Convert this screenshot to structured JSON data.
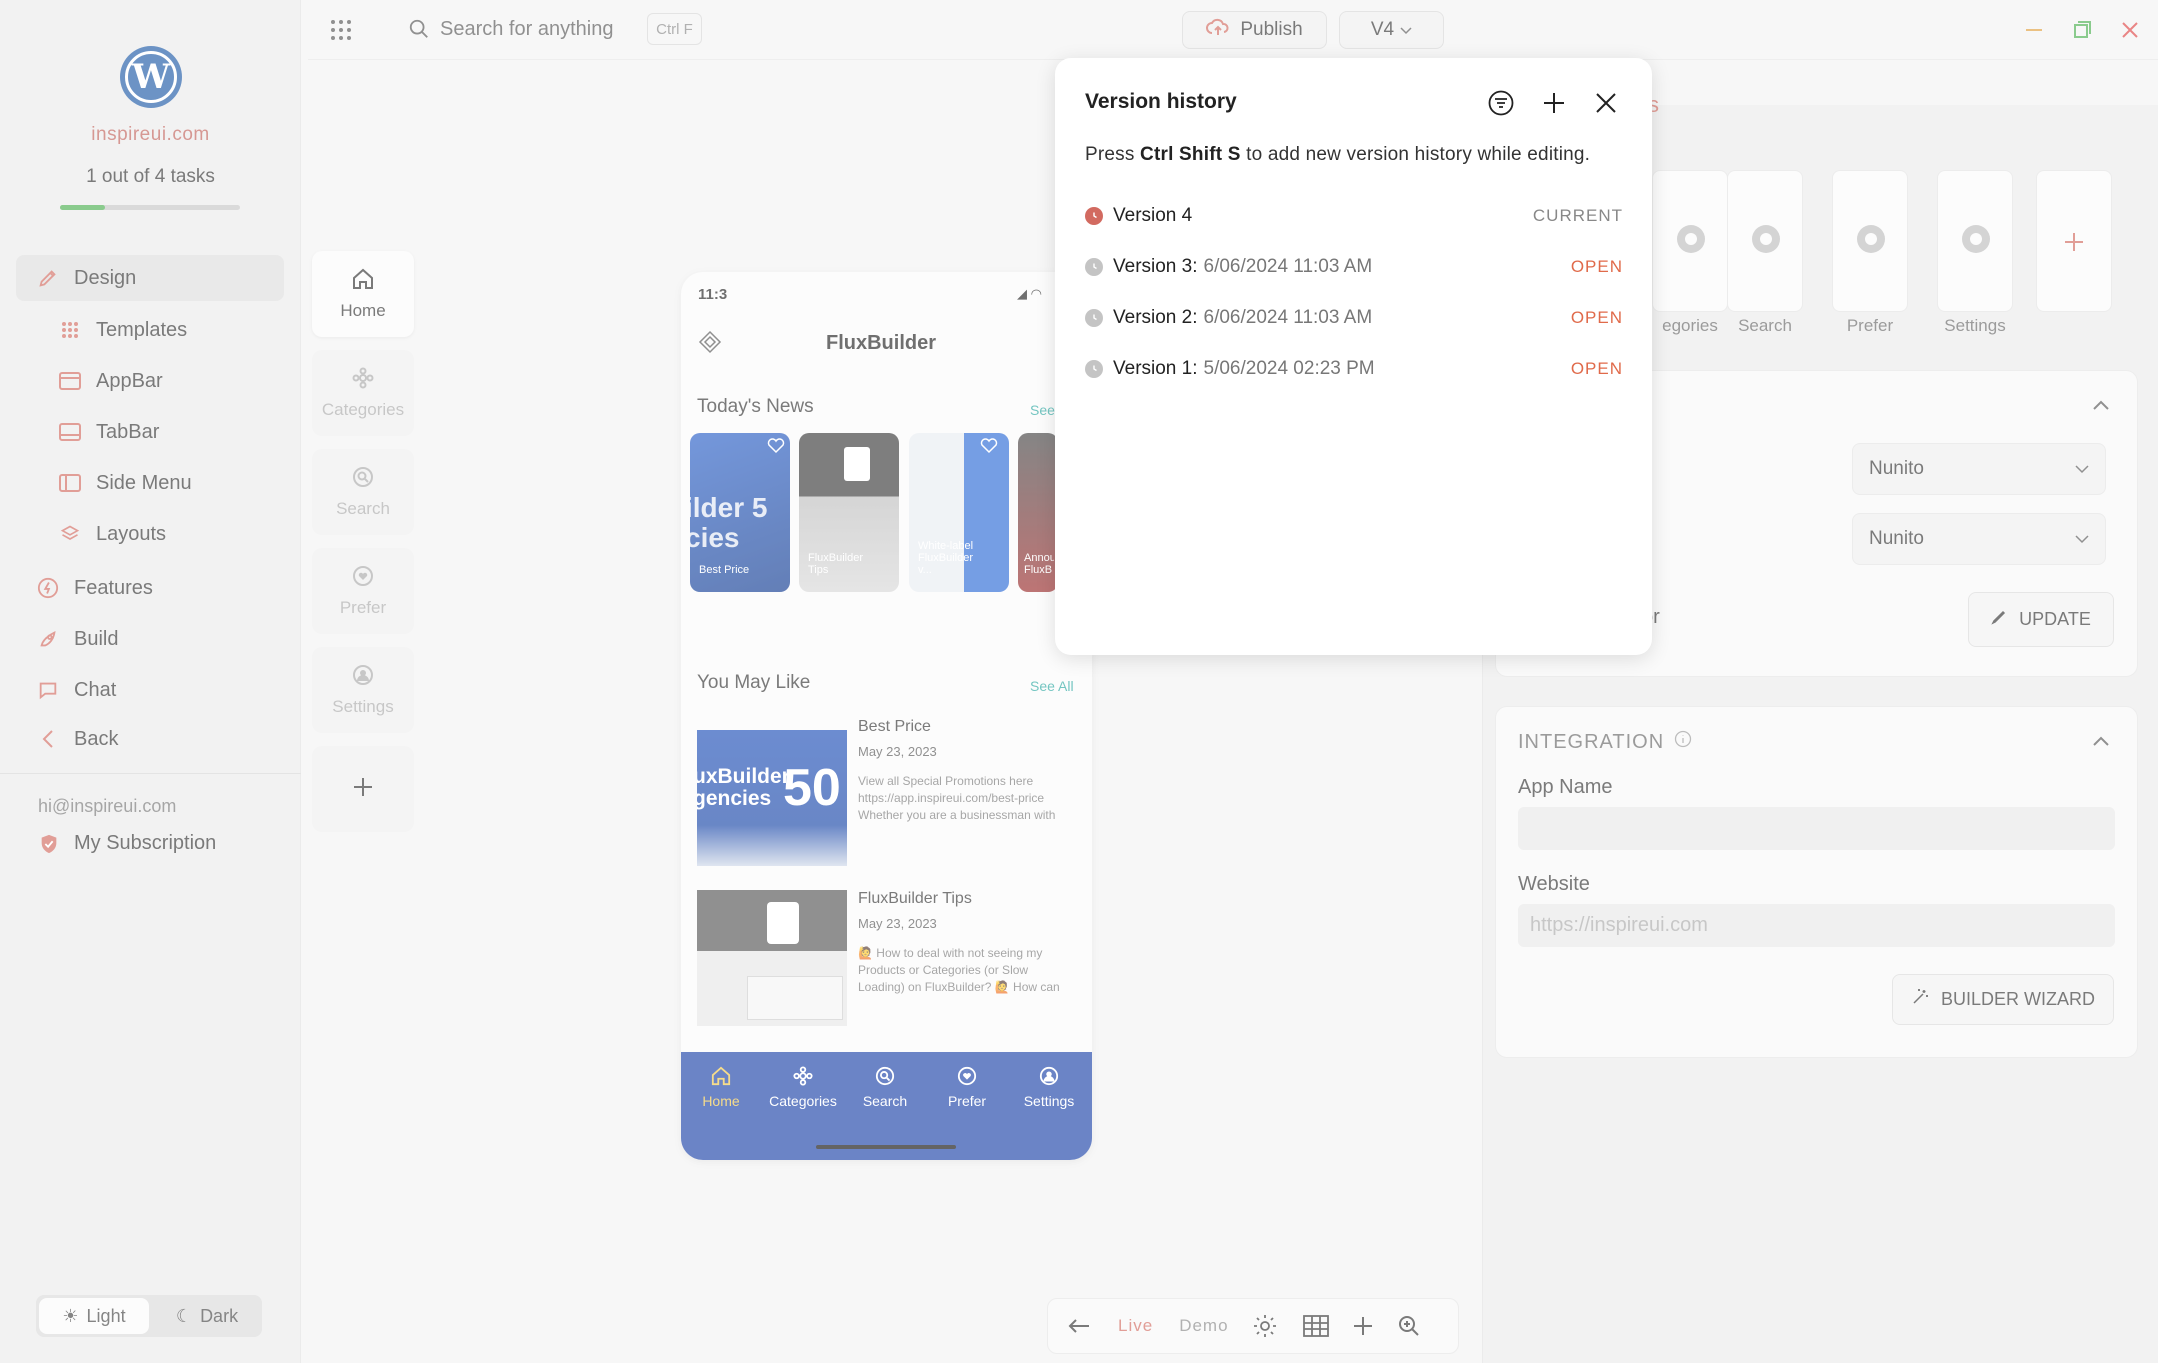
{
  "sidebar": {
    "site_name": "inspireui.com",
    "tasks_text": "1 out of 4 tasks",
    "tasks_progress": 0.25,
    "items": [
      {
        "label": "Design",
        "icon": "design-icon"
      },
      {
        "label": "Templates",
        "icon": "templates-icon"
      },
      {
        "label": "AppBar",
        "icon": "appbar-icon"
      },
      {
        "label": "TabBar",
        "icon": "tabbar-icon"
      },
      {
        "label": "Side Menu",
        "icon": "side-menu-icon"
      },
      {
        "label": "Layouts",
        "icon": "layouts-icon"
      },
      {
        "label": "Features",
        "icon": "features-icon"
      },
      {
        "label": "Build",
        "icon": "build-icon"
      },
      {
        "label": "Chat",
        "icon": "chat-icon"
      },
      {
        "label": "Back",
        "icon": "back-icon"
      }
    ],
    "email": "hi@inspireui.com",
    "subscription": "My Subscription",
    "theme": {
      "light": "Light",
      "dark": "Dark"
    }
  },
  "topbar": {
    "search_placeholder": "Search for anything",
    "shortcut": "Ctrl F",
    "publish": "Publish",
    "version": "V4"
  },
  "rail": {
    "items": [
      "Home",
      "Categories",
      "Search",
      "Prefer",
      "Settings"
    ]
  },
  "phone": {
    "time": "11:3",
    "title": "FluxBuilder",
    "todays_news": "Today's News",
    "see_all_short": "See",
    "news_cards": [
      "Best Price",
      "FluxBuilder Tips",
      "White-label FluxBuilder v...",
      "Annou FluxB"
    ],
    "you_may_like": "You May Like",
    "see_all": "See All",
    "items": [
      {
        "title": "Best Price",
        "date": "May 23, 2023",
        "desc": "View all Special Promotions here https://app.inspireui.com/best-price Whether you are a businessman with"
      },
      {
        "title": "FluxBuilder Tips",
        "date": "May 23, 2023",
        "desc": "🙋 How to deal with not seeing my Products or Categories (or Slow Loading) on FluxBuilder? 🙋 How can"
      }
    ],
    "tabs": [
      "Home",
      "Categories",
      "Search",
      "Prefer",
      "Settings"
    ]
  },
  "right_panel": {
    "heading_fragment": "s",
    "tab_labels": [
      "egories",
      "Search",
      "Prefer",
      "Settings"
    ],
    "font_1": "Nunito",
    "font_2": "Nunito",
    "color_fragment": "or",
    "update": "UPDATE",
    "integration": "INTEGRATION",
    "app_name_label": "App Name",
    "app_name_value": "",
    "website_label": "Website",
    "website_placeholder": "https://inspireui.com",
    "wizard": "BUILDER WIZARD"
  },
  "bottom_bar": {
    "live": "Live",
    "demo": "Demo"
  },
  "modal": {
    "title": "Version history",
    "hint_prefix": "Press ",
    "hint_keys": "Ctrl Shift S",
    "hint_suffix": " to add new version history while editing.",
    "versions": [
      {
        "name": "Version 4",
        "date": "",
        "action": "CURRENT"
      },
      {
        "name": "Version 3:",
        "date": "6/06/2024 11:03 AM",
        "action": "OPEN"
      },
      {
        "name": "Version 2:",
        "date": "6/06/2024 11:03 AM",
        "action": "OPEN"
      },
      {
        "name": "Version 1:",
        "date": "5/06/2024 02:23 PM",
        "action": "OPEN"
      }
    ]
  },
  "colors": {
    "accent": "#d26a60",
    "progress": "#4caf50",
    "phone_tabbar": "#1c43a8",
    "open_action": "#e06a4a"
  }
}
